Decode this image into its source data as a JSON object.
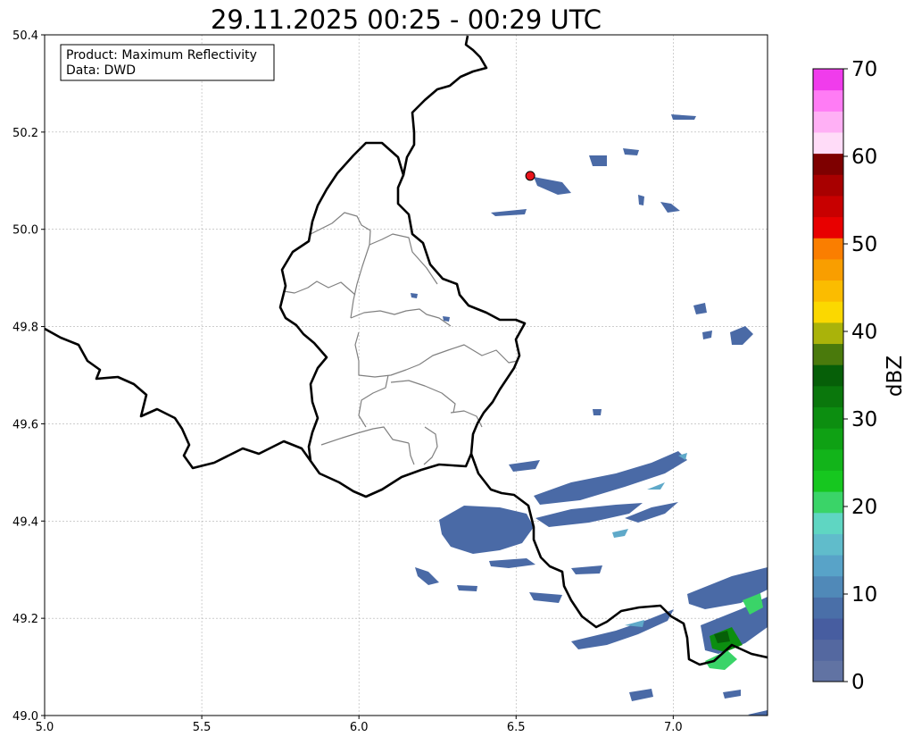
{
  "title": "29.11.2025 00:25 - 00:29 UTC",
  "info_box": {
    "line1": "Product: Maximum Reflectivity",
    "line2": "Data: DWD"
  },
  "map": {
    "lon_range": [
      5.0,
      7.3
    ],
    "lat_range": [
      49.0,
      50.4
    ],
    "x_ticks": [
      "5.0",
      "5.5",
      "6.0",
      "6.5",
      "7.0"
    ],
    "y_ticks": [
      "49.0",
      "49.2",
      "49.4",
      "49.6",
      "49.8",
      "50.0",
      "50.2",
      "50.4"
    ],
    "grid": true,
    "marker": {
      "lon": 6.545,
      "lat": 50.11,
      "color": "#e8141c"
    }
  },
  "colorbar": {
    "unit": "dBZ",
    "range": [
      0,
      70
    ],
    "tick_labels": [
      "0",
      "10",
      "20",
      "30",
      "40",
      "50",
      "60",
      "70"
    ],
    "colors": [
      "#6173a3",
      "#5468a0",
      "#475da0",
      "#4a6fa8",
      "#5089b8",
      "#58a3c8",
      "#60bccb",
      "#5fd6c2",
      "#3ad468",
      "#16c71f",
      "#12b41a",
      "#0fa114",
      "#0c8e10",
      "#0a770c",
      "#065f08",
      "#4a7a0c",
      "#aab30a",
      "#fbd800",
      "#fbbc00",
      "#f99e00",
      "#fa7e00",
      "#e80000",
      "#c80000",
      "#a80000",
      "#7e0000",
      "#ffdcf8",
      "#ffb0f5",
      "#ff7cf5",
      "#f03cec"
    ]
  }
}
